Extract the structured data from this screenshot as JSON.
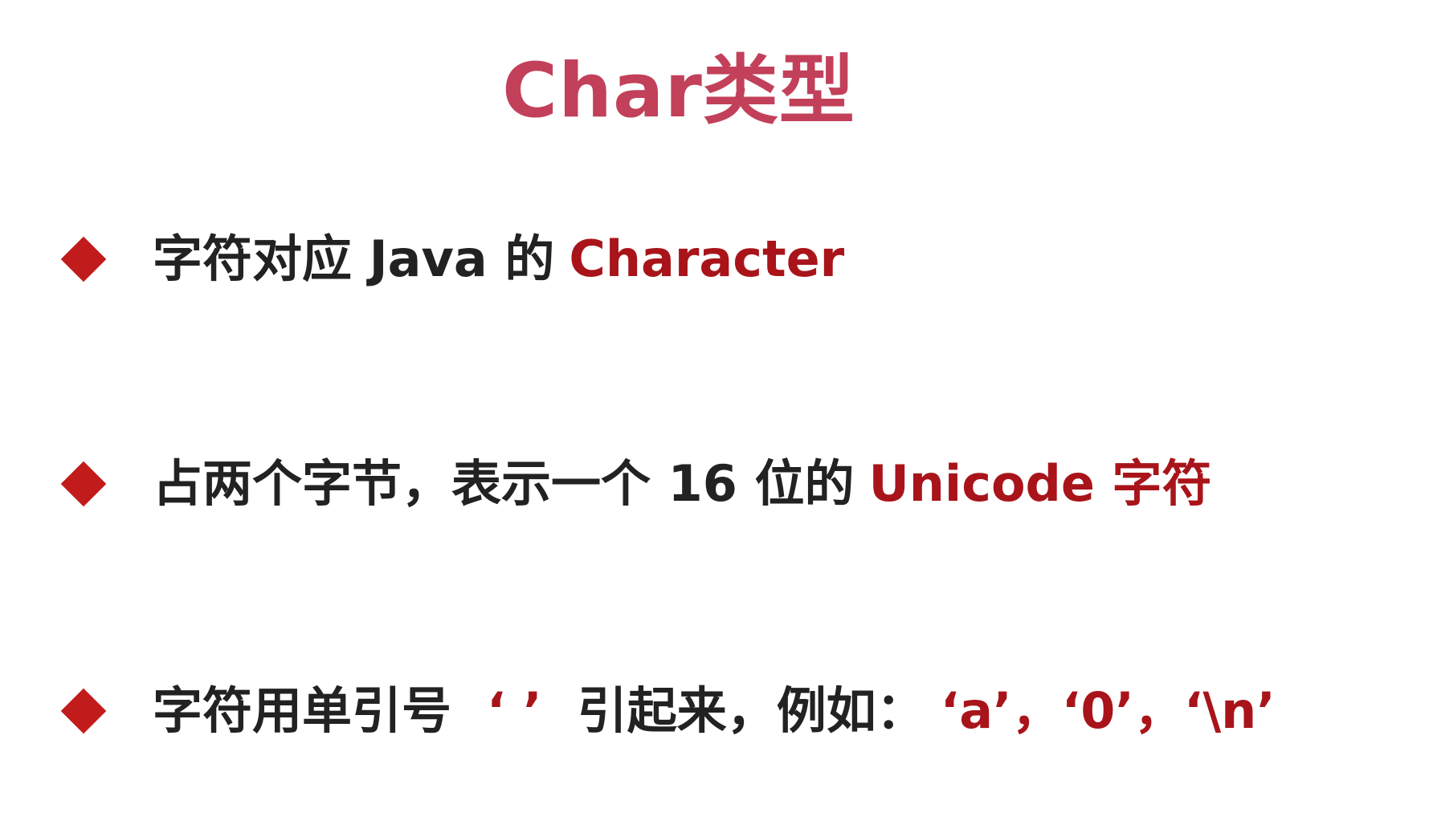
{
  "slide": {
    "title": "Char类型",
    "colors": {
      "title": "#c2405a",
      "bullet": "#c21b1b",
      "highlight": "#a8141a",
      "text": "#222222"
    },
    "bullets": [
      {
        "text_a": "字符对应 Java 的",
        "highlight": "Character"
      },
      {
        "text_a": "占两个字节，表示一个 16 位的",
        "highlight": "Unicode 字符"
      },
      {
        "text_a": "字符用单引号",
        "quote_marks": "‘ ’",
        "text_b": "引起来，例如：",
        "examples": [
          "‘a’",
          "，",
          "‘0’",
          "，",
          "‘\\n’"
        ]
      }
    ]
  }
}
